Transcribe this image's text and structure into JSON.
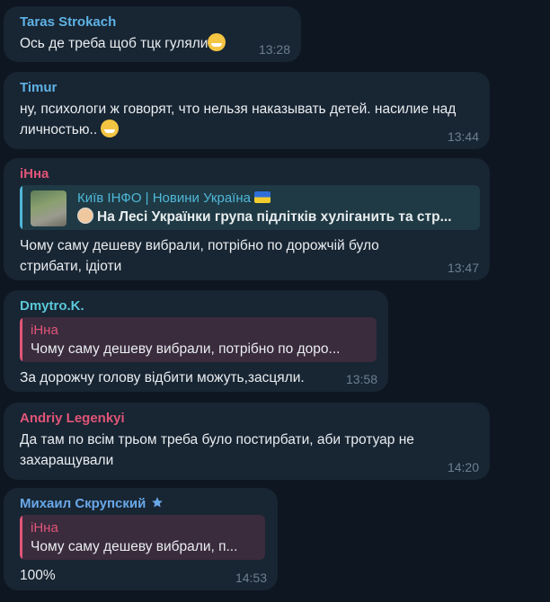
{
  "messages": [
    {
      "sender": "Taras Strokach",
      "text": "Ось де треба щоб тцк гуляли",
      "time": "13:28"
    },
    {
      "sender": "Timur",
      "text": "ну, психологи ж говорят, что нельзя наказывать детей. насилие над личностью..",
      "time": "13:44"
    },
    {
      "sender": "іНна",
      "forward": {
        "channel": "Київ ІНФО | Новини Україна",
        "title": "На Лесі Українки група підлітків хуліганить та стр..."
      },
      "text": "Чому саму дешеву вибрали, потрібно по дорожчій було стрибати, ідіоти",
      "time": "13:47"
    },
    {
      "sender": "Dmytro.K.",
      "reply": {
        "name": "іНна",
        "text": "Чому саму дешеву вибрали, потрібно по доро..."
      },
      "text": "За дорожчу голову відбити можуть,засцяли.",
      "time": "13:58"
    },
    {
      "sender": "Andriy Legenkyi",
      "text": "Да там по всім трьом треба було постирбати, аби тротуар не захаращували",
      "time": "14:20"
    },
    {
      "sender": "Михаил Скрупский",
      "reply": {
        "name": "іНна",
        "text": "Чому саму дешеву вибрали, п..."
      },
      "text": "100%",
      "time": "14:53"
    }
  ],
  "colors": {
    "background": "#0e1621",
    "bubble": "#182533",
    "name_taras": "#5fb3e6",
    "name_timur": "#5fb3e6",
    "name_inna": "#e05577",
    "name_dmytro": "#5ac8d8",
    "name_andriy": "#e05577",
    "name_mykhail": "#69a8e8"
  },
  "icons": [
    "grinning-emoji-icon",
    "sweat-smile-emoji-icon",
    "ukraine-flag-icon",
    "man-emoji-icon",
    "premium-star-icon"
  ]
}
